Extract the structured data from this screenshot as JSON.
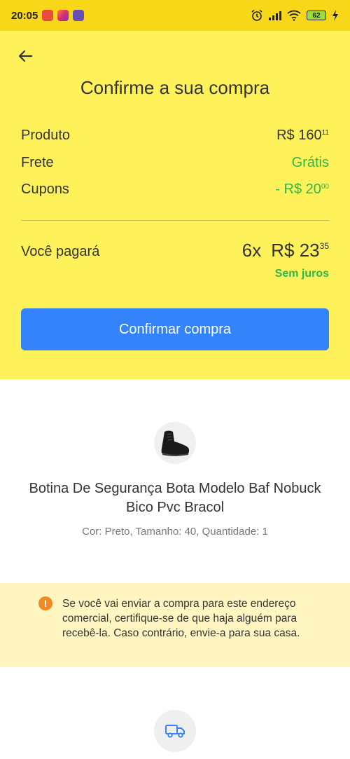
{
  "status_bar": {
    "time": "20:05",
    "battery": "62"
  },
  "header": {
    "title": "Confirme a sua compra"
  },
  "summary": {
    "product_label": "Produto",
    "product_value": "R$ 160",
    "product_cents": "11",
    "shipping_label": "Frete",
    "shipping_value": "Grátis",
    "coupons_label": "Cupons",
    "coupons_value": "- R$ 20",
    "coupons_cents": "00",
    "total_label": "Você pagará",
    "installments": "6x",
    "installment_value": "R$ 23",
    "installment_cents": "35",
    "interest_note": "Sem juros"
  },
  "actions": {
    "confirm_label": "Confirmar compra"
  },
  "product": {
    "title": "Botina De Segurança Bota Modelo Baf Nobuck Bico Pvc Bracol",
    "details": "Cor: Preto, Tamanho: 40, Quantidade: 1"
  },
  "warning": {
    "text": "Se você vai enviar a compra para este endereço comercial, certifique-se de que haja alguém para recebê-la. Caso contrário, envie-a para sua casa."
  },
  "colors": {
    "header_bg": "#fff159",
    "status_bar_bg": "#f7d718",
    "primary_button": "#3483fa",
    "positive_green": "#2db84d",
    "warning_bg": "#fff6c2",
    "warning_icon": "#f08a24"
  },
  "icons": {
    "back": "arrow-left-icon",
    "warning": "exclamation-circle-icon",
    "shipping": "truck-icon"
  }
}
